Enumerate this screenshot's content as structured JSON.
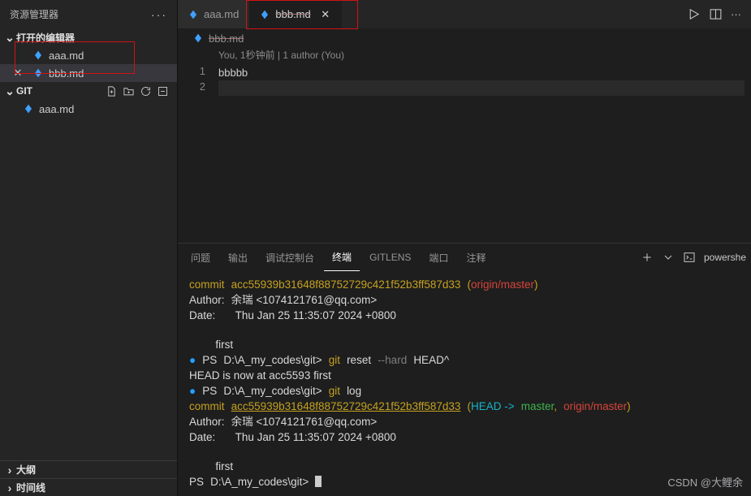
{
  "sidebar": {
    "title": "资源管理器",
    "sections": {
      "openEditors": {
        "label": "打开的编辑器",
        "items": [
          {
            "name": "aaa.md",
            "strike": false,
            "hasClose": false
          },
          {
            "name": "bbb.md",
            "strike": true,
            "hasClose": true
          }
        ]
      },
      "git": {
        "label": "GIT",
        "items": [
          {
            "name": "aaa.md"
          }
        ]
      },
      "outline": {
        "label": "大纲"
      },
      "timeline": {
        "label": "时间线"
      }
    }
  },
  "tabs": [
    {
      "name": "aaa.md",
      "active": false,
      "strike": false
    },
    {
      "name": "bbb.md",
      "active": true,
      "strike": true
    }
  ],
  "breadcrumbFile": "bbb.md",
  "codelens": "You, 1秒钟前 | 1 author (You)",
  "editor": {
    "lines": [
      "1",
      "2"
    ],
    "content": "bbbbb"
  },
  "panel": {
    "tabs": {
      "problems": "问题",
      "output": "输出",
      "debug": "调试控制台",
      "terminal": "终端",
      "gitlens": "GITLENS",
      "ports": "端口",
      "comments": "注释"
    },
    "shell": "powershe"
  },
  "terminal": {
    "commit_label": "commit",
    "commit_hash": "acc55939b31648f88752729c421f52b3ff587d33",
    "origin_master": "origin/master",
    "author_label": "Author:",
    "author_value": "余瑞 <1074121761@qq.com>",
    "date_label": "Date:",
    "date_value": "Thu Jan 25 11:35:07 2024 +0800",
    "msg": "first",
    "prompt_ps": "PS",
    "prompt_path": "D:\\A_my_codes\\git>",
    "cmd_reset_git": "git",
    "cmd_reset_sub": "reset",
    "cmd_reset_flag": "--hard",
    "cmd_reset_arg": "HEAD^",
    "reset_output": "HEAD is now at acc5593 first",
    "cmd_log_git": "git",
    "cmd_log_sub": "log",
    "head_arrow": "HEAD ->",
    "master": "master",
    "origin_master2": "origin/master"
  },
  "watermark": "CSDN @大鲤余"
}
